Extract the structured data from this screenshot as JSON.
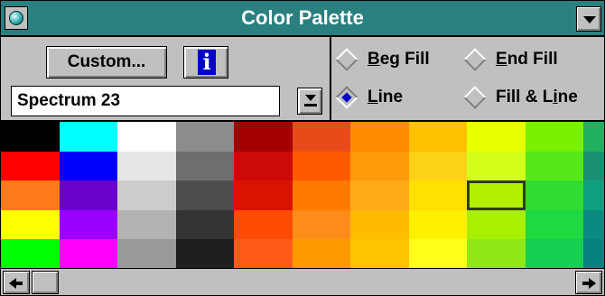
{
  "window": {
    "title": "Color Palette"
  },
  "icons": {
    "system_menu": "teal-orb-icon",
    "minimize": "triangle-down-icon",
    "info": "info-i-icon",
    "dropdown": "down-arrow-bar-icon",
    "scroll_left": "arrow-left-icon",
    "scroll_right": "arrow-right-icon"
  },
  "toolbar": {
    "custom_label": "Custom...",
    "info_glyph": "i"
  },
  "palette_select": {
    "value": "Spectrum 23"
  },
  "fill_modes": {
    "beg_fill": {
      "label": "Beg Fill",
      "selected": false
    },
    "end_fill": {
      "label": "End Fill",
      "selected": false
    },
    "line": {
      "label": "Line",
      "selected": true
    },
    "fill_line": {
      "label": "Fill & Line",
      "selected": false
    }
  },
  "swatches": {
    "columns": [
      [
        "#000000",
        "#ff0000",
        "#ff7a1a",
        "#ffff00",
        "#00ff00"
      ],
      [
        "#00ffff",
        "#0000ff",
        "#6a00cc",
        "#9b00ff",
        "#ff00ff"
      ],
      [
        "#ffffff",
        "#e6e6e6",
        "#cccccc",
        "#b3b3b3",
        "#999999"
      ],
      [
        "#8c8c8c",
        "#6e6e6e",
        "#4d4d4d",
        "#333333",
        "#1f1f1f"
      ],
      [
        "#a40000",
        "#cc0a0a",
        "#d81400",
        "#ff4a00",
        "#ff5a1a"
      ],
      [
        "#e84a1a",
        "#ff5a00",
        "#ff7a00",
        "#ff8c1a",
        "#ff9a00"
      ],
      [
        "#ff8c00",
        "#ff9a0a",
        "#ffac1a",
        "#ffbb00",
        "#ffc400"
      ],
      [
        "#ffc000",
        "#ffd21a",
        "#ffe000",
        "#fff000",
        "#ffff1a"
      ],
      [
        "#e8ff00",
        "#d4ff1a",
        "#b0f000",
        "#a8f000",
        "#90e818"
      ],
      [
        "#78f000",
        "#56e81a",
        "#30dc30",
        "#20d840",
        "#14d050"
      ],
      [
        "#20b060",
        "#188f70",
        "#10a080",
        "#0a8a80",
        "#088080"
      ]
    ],
    "selected": {
      "column": 8,
      "row": 2
    }
  }
}
